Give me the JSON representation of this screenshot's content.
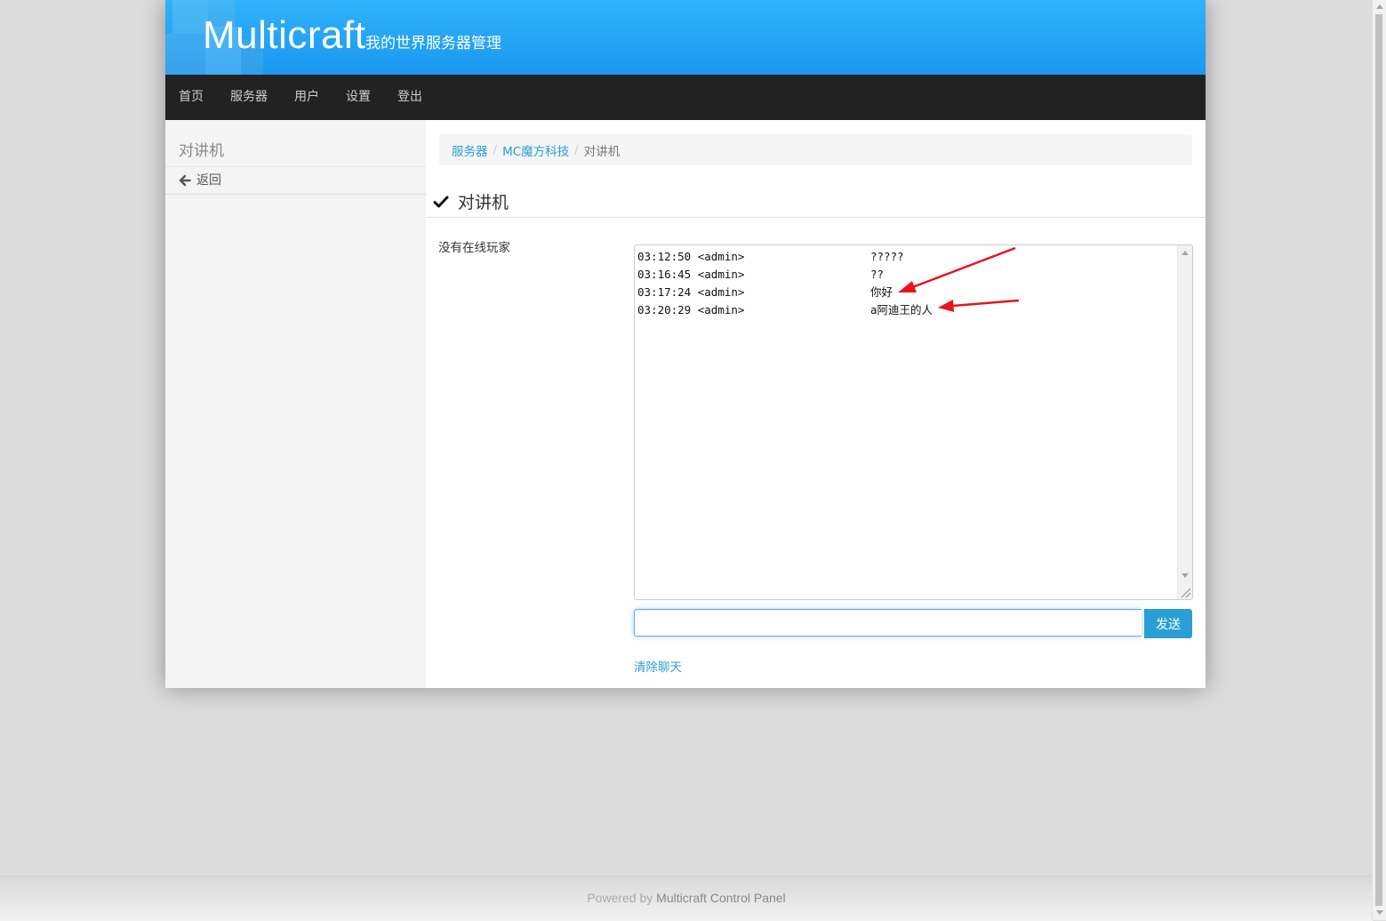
{
  "header": {
    "title": "Multicraft",
    "subtitle": "我的世界服务器管理"
  },
  "nav": {
    "items": [
      {
        "label": "首页"
      },
      {
        "label": "服务器"
      },
      {
        "label": "用户"
      },
      {
        "label": "设置"
      },
      {
        "label": "登出"
      }
    ]
  },
  "sidebar": {
    "title": "对讲机",
    "back_label": "返回"
  },
  "breadcrumb": {
    "items": [
      {
        "label": "服务器"
      },
      {
        "label": "MC魔方科技"
      },
      {
        "label": "对讲机"
      }
    ],
    "separator": "/"
  },
  "main": {
    "heading": "对讲机",
    "no_players": "没有在线玩家",
    "chat_log": [
      {
        "time": "03:12:50",
        "user": "<admin>",
        "message": "?????"
      },
      {
        "time": "03:16:45",
        "user": "<admin>",
        "message": "??"
      },
      {
        "time": "03:17:24",
        "user": "<admin>",
        "message": "你好"
      },
      {
        "time": "03:20:29",
        "user": "<admin>",
        "message": "a阿迪王的人"
      }
    ],
    "input_value": "",
    "send_label": "发送",
    "clear_label": "清除聊天"
  },
  "footer": {
    "prefix": "Powered by ",
    "link": "Multicraft Control Panel"
  },
  "colors": {
    "header_blue": "#1b97f0",
    "navbar": "#222222",
    "link": "#2a9fd6",
    "send_button": "#2a9fd6",
    "annotation_arrow": "#e8141c"
  }
}
